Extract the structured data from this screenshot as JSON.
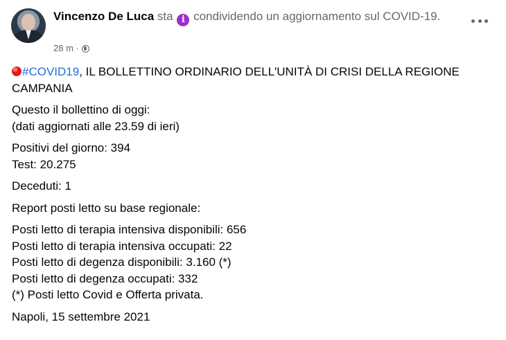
{
  "post": {
    "author": "Vincenzo De Luca",
    "activity_prefix": "sta",
    "activity_icon": "info-icon",
    "activity_text": "condividendo un aggiornamento sul COVID-19.",
    "time": "28 m",
    "separator": "·",
    "privacy_icon": "globe-icon",
    "more_icon": "more-options-icon"
  },
  "content": {
    "hashtag": "#COVID19",
    "title_rest": ", IL BOLLETTINO ORDINARIO DELL'UNITÀ DI CRISI DELLA REGIONE CAMPANIA",
    "intro_line1": "Questo il bollettino di oggi:",
    "intro_line2": "(dati aggiornati alle 23.59 di ieri)",
    "positivi": "Positivi del giorno: 394",
    "test": "Test: 20.275",
    "deceduti": "Deceduti: 1",
    "report": "Report posti letto su base regionale:",
    "beds": [
      "Posti letto di terapia intensiva disponibili: 656",
      "Posti letto di terapia intensiva occupati: 22",
      "Posti letto di degenza disponibili: 3.160 (*)",
      "Posti letto di degenza occupati: 332",
      "(*) Posti letto Covid e Offerta privata."
    ],
    "signature": "Napoli, 15 settembre 2021"
  },
  "colors": {
    "hashtag": "#216fdb",
    "secondary_text": "#65676b",
    "info_icon": "#9b2fc8",
    "red_dot": "#e31b1b"
  }
}
